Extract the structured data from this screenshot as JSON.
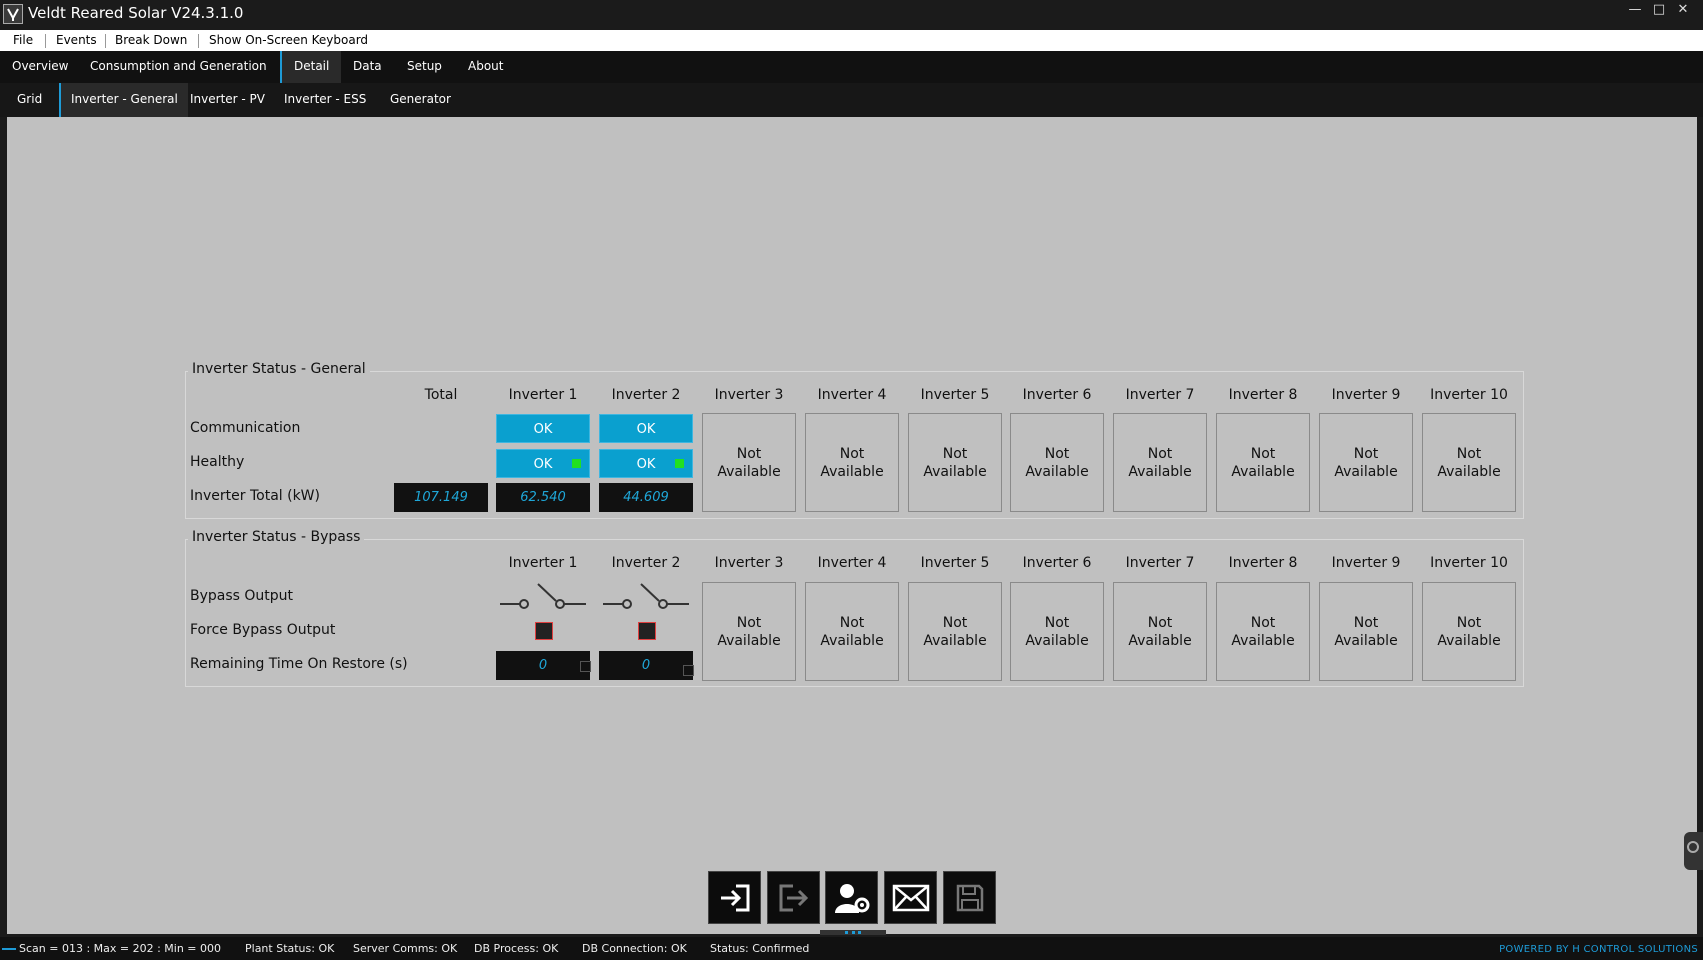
{
  "window": {
    "title": "Veldt Reared Solar V24.3.1.0"
  },
  "menu": {
    "items": [
      "File",
      "Events",
      "Break Down",
      "Show On-Screen Keyboard"
    ]
  },
  "main_tabs": {
    "items": [
      "Overview",
      "Consumption and Generation",
      "Detail",
      "Data",
      "Setup",
      "About"
    ],
    "active": "Detail"
  },
  "sub_tabs": {
    "items": [
      "Grid",
      "Inverter - General",
      "Inverter - PV",
      "Inverter - ESS",
      "Generator"
    ],
    "active": "Inverter - General"
  },
  "general": {
    "title": "Inverter Status - General",
    "total_header": "Total",
    "columns": [
      "Inverter 1",
      "Inverter 2",
      "Inverter 3",
      "Inverter 4",
      "Inverter 5",
      "Inverter 6",
      "Inverter 7",
      "Inverter 8",
      "Inverter 9",
      "Inverter 10"
    ],
    "rows": [
      "Communication",
      "Healthy",
      "Inverter Total (kW)"
    ],
    "communication": [
      "OK",
      "OK"
    ],
    "healthy": [
      "OK",
      "OK"
    ],
    "inverter_total": {
      "total": "107.149",
      "values": [
        "62.540",
        "44.609"
      ]
    },
    "not_available_line1": "Not",
    "not_available_line2": "Available"
  },
  "bypass": {
    "title": "Inverter Status - Bypass",
    "columns": [
      "Inverter 1",
      "Inverter 2",
      "Inverter 3",
      "Inverter 4",
      "Inverter 5",
      "Inverter 6",
      "Inverter 7",
      "Inverter 8",
      "Inverter 9",
      "Inverter 10"
    ],
    "rows": [
      "Bypass Output",
      "Force Bypass Output",
      "Remaining Time On Restore (s)"
    ],
    "remaining_time": [
      "0",
      "0"
    ]
  },
  "toolbar": {
    "icons": [
      "login-icon",
      "logout-icon",
      "user-settings-icon",
      "mail-icon",
      "save-icon"
    ]
  },
  "status": {
    "scan": "Scan = 013 : Max = 202 : Min = 000",
    "plant": "Plant Status: OK",
    "server": "Server Comms: OK",
    "db_process": "DB Process:  OK",
    "db_connection": "DB Connection:  OK",
    "status": "Status:  Confirmed",
    "powered_by": "POWERED BY H CONTROL SOLUTIONS"
  },
  "colors": {
    "accent": "#1e9bd7",
    "ok": "#0aa0cf",
    "led": "#22e022"
  }
}
